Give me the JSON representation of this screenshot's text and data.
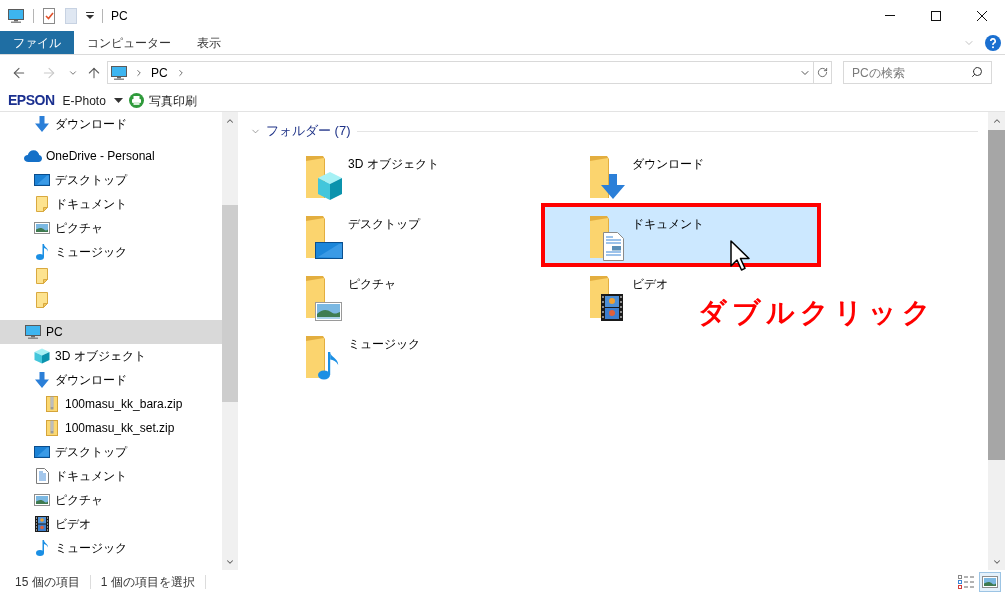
{
  "window": {
    "title": "PC"
  },
  "ribbon": {
    "tabs": [
      {
        "label": "ファイル",
        "selected": true
      },
      {
        "label": "コンピューター",
        "selected": false
      },
      {
        "label": "表示",
        "selected": false
      }
    ]
  },
  "navigation": {
    "buttons": [
      {
        "kind": "back",
        "disabled": false
      },
      {
        "kind": "forward",
        "disabled": true
      },
      {
        "kind": "recent",
        "disabled": false
      },
      {
        "kind": "up",
        "disabled": false
      }
    ],
    "path": [
      "PC"
    ]
  },
  "search": {
    "placeholder": "PCの検索"
  },
  "epson_toolbar": {
    "brand": "EPSON",
    "menu": "E-Photo",
    "action": "写真印刷"
  },
  "nav_pane": {
    "partial_group": [
      {
        "label": "ダウンロード",
        "kind": "download",
        "selected": false
      }
    ],
    "items": [
      {
        "label": "OneDrive - Personal",
        "kind": "cloud",
        "selected": false,
        "children": [
          {
            "label": "デスクトップ",
            "kind": "desktop",
            "selected": false
          },
          {
            "label": "ドキュメント",
            "kind": "folder",
            "selected": false
          },
          {
            "label": "ピクチャ",
            "kind": "pictures",
            "selected": false
          },
          {
            "label": "ミュージック",
            "kind": "music",
            "selected": false
          },
          {
            "kind": "folder",
            "selected": false
          },
          {
            "kind": "folder",
            "selected": false
          }
        ]
      },
      {
        "label": "PC",
        "kind": "pc",
        "selected": true,
        "children": [
          {
            "label": "3D オブジェクト",
            "kind": "objects3d",
            "selected": false
          },
          {
            "label": "ダウンロード",
            "kind": "download",
            "selected": false,
            "children": [
              {
                "label": "100masu_kk_bara.zip",
                "kind": "zip",
                "selected": false
              },
              {
                "label": "100masu_kk_set.zip",
                "kind": "zip",
                "selected": false
              }
            ]
          },
          {
            "label": "デスクトップ",
            "kind": "desktop",
            "selected": false
          },
          {
            "label": "ドキュメント",
            "kind": "documents",
            "selected": false
          },
          {
            "label": "ピクチャ",
            "kind": "pictures",
            "selected": false
          },
          {
            "label": "ビデオ",
            "kind": "video",
            "selected": false
          },
          {
            "label": "ミュージック",
            "kind": "music",
            "selected": false
          }
        ]
      }
    ]
  },
  "content": {
    "group": {
      "title": "フォルダー (7)",
      "expanded": true
    },
    "tiles": [
      {
        "label": "3D オブジェクト",
        "kind": "objects3d",
        "selected": false,
        "highlighted": false
      },
      {
        "label": "ダウンロード",
        "kind": "download",
        "selected": false,
        "highlighted": false
      },
      {
        "label": "デスクトップ",
        "kind": "desktop",
        "selected": false,
        "highlighted": false
      },
      {
        "label": "ドキュメント",
        "kind": "documents",
        "selected": true,
        "highlighted": true
      },
      {
        "label": "ピクチャ",
        "kind": "pictures",
        "selected": false,
        "highlighted": false
      },
      {
        "label": "ビデオ",
        "kind": "video",
        "selected": false,
        "highlighted": false
      },
      {
        "label": "ミュージック",
        "kind": "music",
        "selected": false,
        "highlighted": false
      }
    ]
  },
  "annotation": {
    "text": "ダブルクリック"
  },
  "status_bar": {
    "item_count": "15 個の項目",
    "selection": "1 個の項目を選択",
    "view_modes": [
      {
        "kind": "details",
        "selected": false
      },
      {
        "kind": "large-icons",
        "selected": true
      }
    ]
  }
}
